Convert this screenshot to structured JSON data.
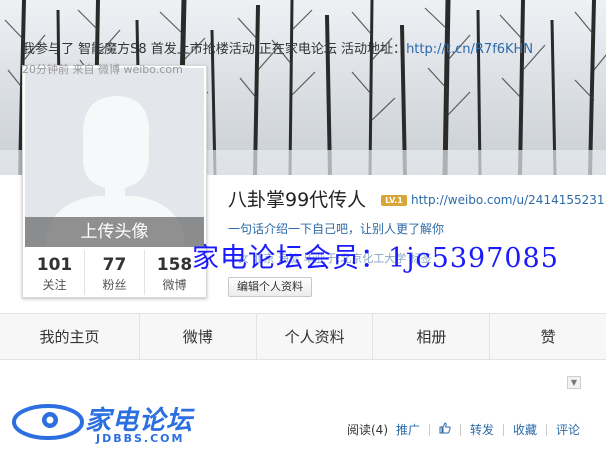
{
  "profile": {
    "upload_avatar_label": "上传头像",
    "username": "八卦掌99代传人",
    "vip_badge": "LV.1",
    "url": "http://weibo.com/u/2414155231",
    "intro": "一句话介绍一下自己吧，让别人更了解你",
    "meta": "女  北京 海淀      毕业于:北京化工大学   标签",
    "edit_button": "编辑个人资料",
    "stats": [
      {
        "num": "101",
        "label": "关注"
      },
      {
        "num": "77",
        "label": "粉丝"
      },
      {
        "num": "158",
        "label": "微博"
      }
    ]
  },
  "watermark": {
    "forum_member": "家电论坛会员：1jc5397085",
    "logo_text": "家电论坛",
    "logo_sub": "JDBBS.COM"
  },
  "nav": {
    "items": [
      "我的主页",
      "微博",
      "个人资料",
      "相册",
      "赞"
    ]
  },
  "feed": {
    "prefix": "我参与了 智能魔方S8 首发上市抢楼活动 正在家电论坛 活动地址：",
    "link": "http://t.cn/R7f6KHN",
    "from": "20分钟前 来自 微博 weibo.com",
    "actions": {
      "read": "阅读(4)",
      "promote": "推广",
      "forward": "转发",
      "favorite": "收藏",
      "comment": "评论"
    }
  },
  "colors": {
    "link": "#2b6aa8",
    "watermark_blue": "#1a1aff",
    "logo_blue": "#2b6fe0"
  }
}
